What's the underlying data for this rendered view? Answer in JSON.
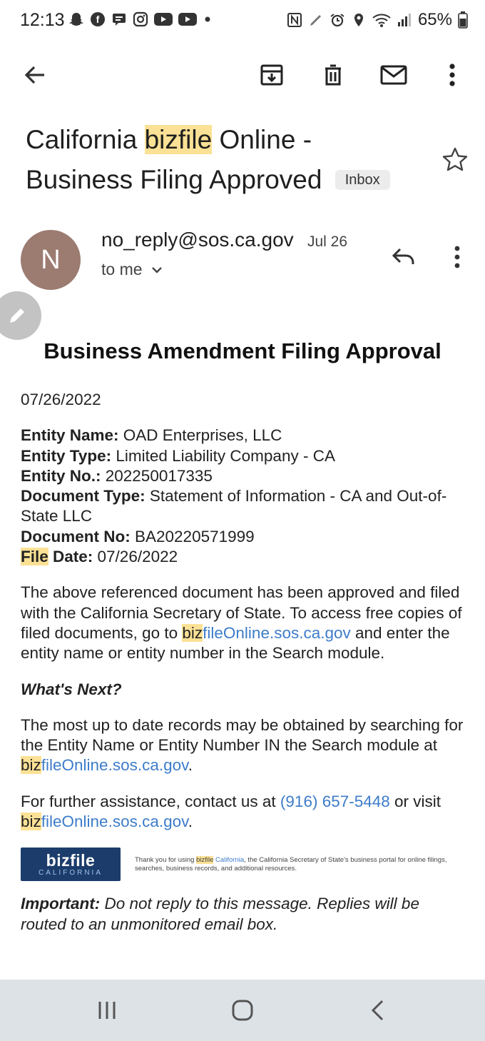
{
  "status_bar": {
    "time": "12:13",
    "battery": "65%",
    "left_icons": [
      "snapchat-icon",
      "facebook-icon",
      "chat-icon",
      "instagram-icon",
      "youtube-icon",
      "youtube-icon",
      "dot-icon"
    ],
    "right_icons": [
      "nfc-icon",
      "pen-icon",
      "alarm-icon",
      "location-icon",
      "wifi-icon",
      "signal-icon",
      "battery-icon"
    ]
  },
  "app_bar": {
    "icons": [
      "back-arrow-icon",
      "archive-icon",
      "trash-icon",
      "mail-icon",
      "more-vert-icon"
    ]
  },
  "email": {
    "subject_part1": "California ",
    "subject_highlight": "bizfile",
    "subject_part2": " Online - Business Filing Approved",
    "label": "Inbox",
    "avatar_letter": "N",
    "avatar_color": "#9c7b71",
    "sender": "no_reply@sos.ca.gov",
    "date": "Jul 26",
    "recipient": "to me",
    "heading": "Business Amendment Filing Approval",
    "filing_date": "07/26/2022",
    "fields": {
      "entity_name_label": "Entity Name:",
      "entity_name": " OAD Enterprises, LLC",
      "entity_type_label": "Entity Type:",
      "entity_type": " Limited Liability Company - CA",
      "entity_no_label": "Entity No.:",
      "entity_no": " 202250017335",
      "document_type_label": "Document Type:",
      "document_type": " Statement of Information - CA and Out-of-State LLC",
      "document_no_label": "Document No:",
      "document_no": " BA20220571999",
      "file_date_label_hl": "File",
      "file_date_label_rest": " Date:",
      "file_date": " 07/26/2022"
    },
    "para1_text": "The above referenced document has been approved and filed with the California Secretary of State. To access free copies of filed documents, go to ",
    "link_hl": "biz",
    "link_rest": "fileOnline.sos.ca.gov",
    "para1_end": " and enter the entity name or entity number in the Search module.",
    "whats_next": "What's Next?",
    "para2_text": "The most up to date records may be obtained by searching for the Entity Name or Entity Number IN the Search module at ",
    "para2_end": ".",
    "para3_text": "For further assistance, contact us at ",
    "phone": "(916) 657-5448",
    "para3_mid": " or visit ",
    "para3_end": ".",
    "logo_top": "bizfile",
    "logo_bottom": "CALIFORNIA",
    "footer_note_1": "Thank you for using ",
    "footer_note_hl": "bizfile",
    "footer_note_link": " California",
    "footer_note_2": ", the California Secretary of State's business portal for online filings, searches, business records, and additional resources.",
    "important_label": "Important:",
    "important_text": " Do not reply to this message. Replies will be routed to an unmonitored email box."
  },
  "colors": {
    "highlight": "#fbe195",
    "link": "#3d7cc9",
    "logo_bg": "#1c3d6b",
    "nav_bg": "#dde2e7"
  },
  "nav_bar": {
    "icons": [
      "recent-apps-icon",
      "home-icon",
      "back-icon"
    ]
  }
}
